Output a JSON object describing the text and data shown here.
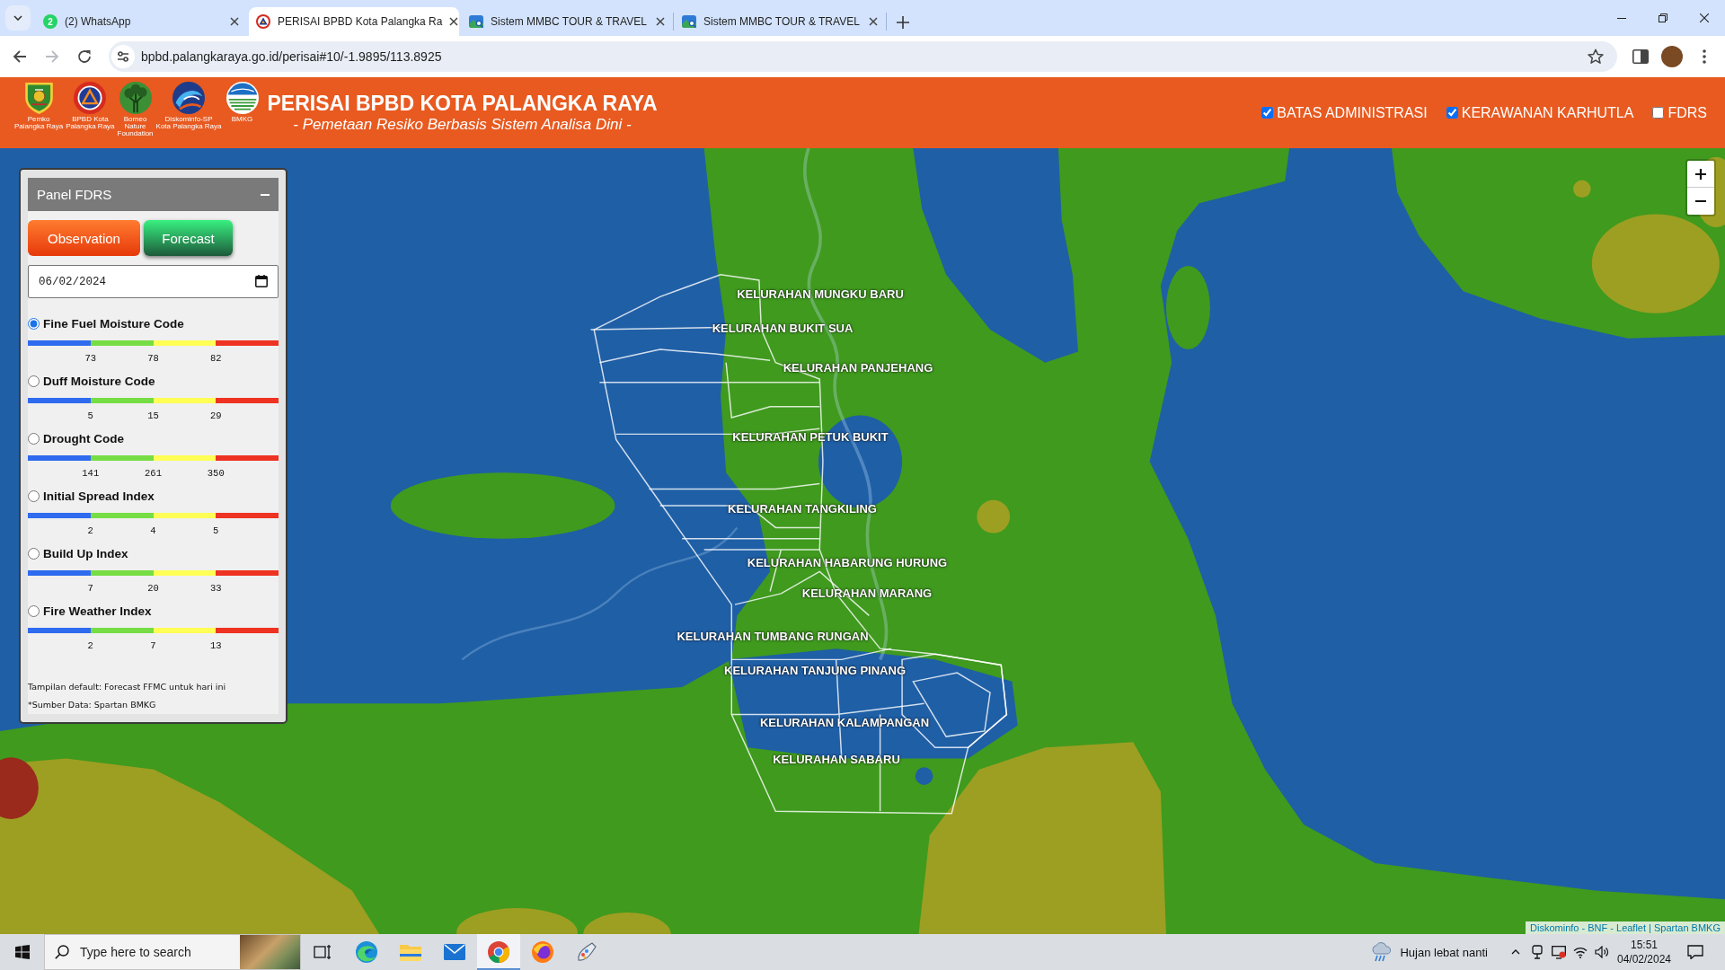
{
  "browser": {
    "tabs": [
      {
        "kind": "badge",
        "badge": "2",
        "title": "(2) WhatsApp",
        "selected": false
      },
      {
        "kind": "emblem",
        "title": "PERISAI BPBD Kota Palangka Ra",
        "selected": true
      },
      {
        "kind": "landscape",
        "title": "Sistem MMBC TOUR & TRAVEL",
        "selected": false
      },
      {
        "kind": "landscape",
        "title": "Sistem MMBC TOUR & TRAVEL",
        "selected": false
      }
    ],
    "nav": [
      {
        "kind": "back",
        "disabled": false
      },
      {
        "kind": "forward",
        "disabled": true
      },
      {
        "kind": "reload",
        "disabled": false
      }
    ],
    "address": "bpbd.palangkaraya.go.id/perisai#10/-1.9895/113.8925"
  },
  "header": {
    "logos": [
      {
        "kind": "shield",
        "caption": "Pemko\nPalangka Raya"
      },
      {
        "kind": "triangle",
        "caption": "BPBD Kota\nPalangka Raya"
      },
      {
        "kind": "tree",
        "caption": "Borneo\nNature\nFoundation"
      },
      {
        "kind": "swirl",
        "caption": "Diskominfo-SP\nKota Palangka Raya"
      },
      {
        "kind": "waves",
        "caption": "BMKG"
      }
    ],
    "title": "PERISAI BPBD KOTA PALANGKA RAYA",
    "subtitle": "- Pemetaan Resiko Berbasis Sistem Analisa Dini -",
    "layers": [
      {
        "label": "BATAS ADMINISTRASI",
        "checked": true
      },
      {
        "label": "KERAWANAN KARHUTLA",
        "checked": true
      },
      {
        "label": "FDRS",
        "checked": false
      }
    ]
  },
  "panel": {
    "title": "Panel FDRS",
    "buttons": [
      {
        "kind": "observation",
        "label": "Observation"
      },
      {
        "kind": "forecast",
        "label": "Forecast"
      }
    ],
    "date": "06/02/2024",
    "indices": [
      {
        "name": "Fine Fuel Moisture Code",
        "selected": true,
        "thresholds": [
          "73",
          "78",
          "82"
        ]
      },
      {
        "name": "Duff Moisture Code",
        "selected": false,
        "thresholds": [
          "5",
          "15",
          "29"
        ]
      },
      {
        "name": "Drought Code",
        "selected": false,
        "thresholds": [
          "141",
          "261",
          "350"
        ]
      },
      {
        "name": "Initial Spread Index",
        "selected": false,
        "thresholds": [
          "2",
          "4",
          "5"
        ]
      },
      {
        "name": "Build Up Index",
        "selected": false,
        "thresholds": [
          "7",
          "20",
          "33"
        ]
      },
      {
        "name": "Fire Weather Index",
        "selected": false,
        "thresholds": [
          "2",
          "7",
          "13"
        ]
      }
    ],
    "notes": [
      "Tampilan default: Forecast FFMC untuk hari ini",
      "*Sumber Data: Spartan BMKG"
    ]
  },
  "map": {
    "labels": [
      "KELURAHAN MUNGKU BARU",
      "KELURAHAN BUKIT SUA",
      "KELURAHAN PANJEHANG",
      "KELURAHAN PETUK BUKIT",
      "KELURAHAN TANGKILING",
      "KELURAHAN HABARUNG HURUNG",
      "KELURAHAN MARANG",
      "KELURAHAN TUMBANG RUNGAN",
      "KELURAHAN TANJUNG PINANG",
      "KELURAHAN KALAMPANGAN",
      "KELURAHAN SABARU"
    ],
    "attribution": {
      "before": "Diskominfo - BNF -",
      "link": "Leaflet",
      "after": "| Spartan BMKG"
    }
  },
  "taskbar": {
    "search_placeholder": "Type here to search",
    "apps": [
      {
        "kind": "taskview",
        "selected": false
      },
      {
        "kind": "wave",
        "selected": false
      },
      {
        "kind": "folder",
        "selected": false
      },
      {
        "kind": "mail",
        "selected": false
      },
      {
        "kind": "orb",
        "selected": true
      },
      {
        "kind": "fox",
        "selected": false
      },
      {
        "kind": "brush",
        "selected": false
      }
    ],
    "weather": "Hujan lebat nanti",
    "time": "15:51",
    "date": "04/02/2024"
  }
}
